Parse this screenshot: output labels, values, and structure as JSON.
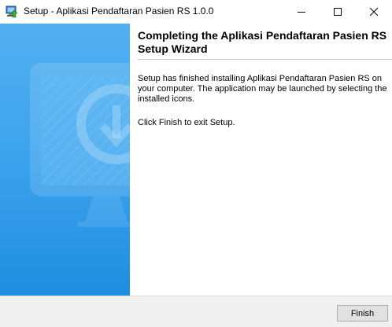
{
  "window": {
    "title": "Setup - Aplikasi Pendaftaran Pasien RS 1.0.0",
    "icon": "setup-installer-icon",
    "controls": [
      "minimize-icon",
      "maximize-icon",
      "close-icon"
    ]
  },
  "side_panel": {
    "graphic": "monitor-download-icon",
    "colors": {
      "top": "#52b0f0",
      "bottom": "#1f8de0"
    }
  },
  "main": {
    "heading": "Completing the Aplikasi Pendaftaran Pasien RS Setup Wizard",
    "paragraphs": [
      "Setup has finished installing Aplikasi Pendaftaran Pasien RS on your computer. The application may be launched by selecting the installed icons.",
      "Click Finish to exit Setup."
    ]
  },
  "footer": {
    "finish_label": "Finish"
  }
}
